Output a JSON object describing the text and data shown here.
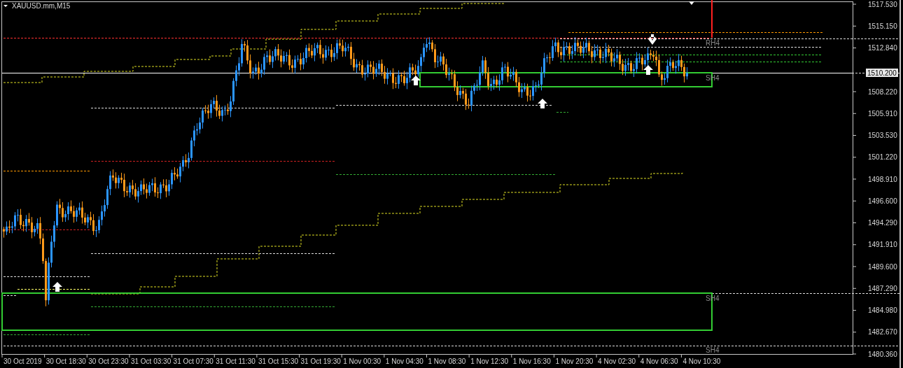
{
  "chart": {
    "title": "XAUUSD.mm,M15",
    "current_price": "1510.200",
    "price_axis": [
      "1517.530",
      "1515.150",
      "1512.840",
      "1508.220",
      "1505.910",
      "1503.530",
      "1501.220",
      "1498.910",
      "1496.600",
      "1494.290",
      "1491.910",
      "1489.600",
      "1487.290",
      "1484.980",
      "1482.670",
      "1480.360"
    ],
    "time_axis": [
      "30 Oct 2019",
      "30 Oct 18:30",
      "30 Oct 23:30",
      "31 Oct 03:30",
      "31 Oct 07:30",
      "31 Oct 11:30",
      "31 Oct 15:30",
      "31 Oct 19:30",
      "1 Nov 00:30",
      "1 Nov 04:30",
      "1 Nov 08:30",
      "1 Nov 12:30",
      "1 Nov 16:30",
      "1 Nov 20:30",
      "4 Nov 02:30",
      "4 Nov 06:30",
      "4 Nov 10:30"
    ],
    "level_labels": [
      {
        "text": "RH4"
      },
      {
        "text": "SH4"
      },
      {
        "text": "SH4"
      },
      {
        "text": "SH4"
      }
    ]
  }
}
